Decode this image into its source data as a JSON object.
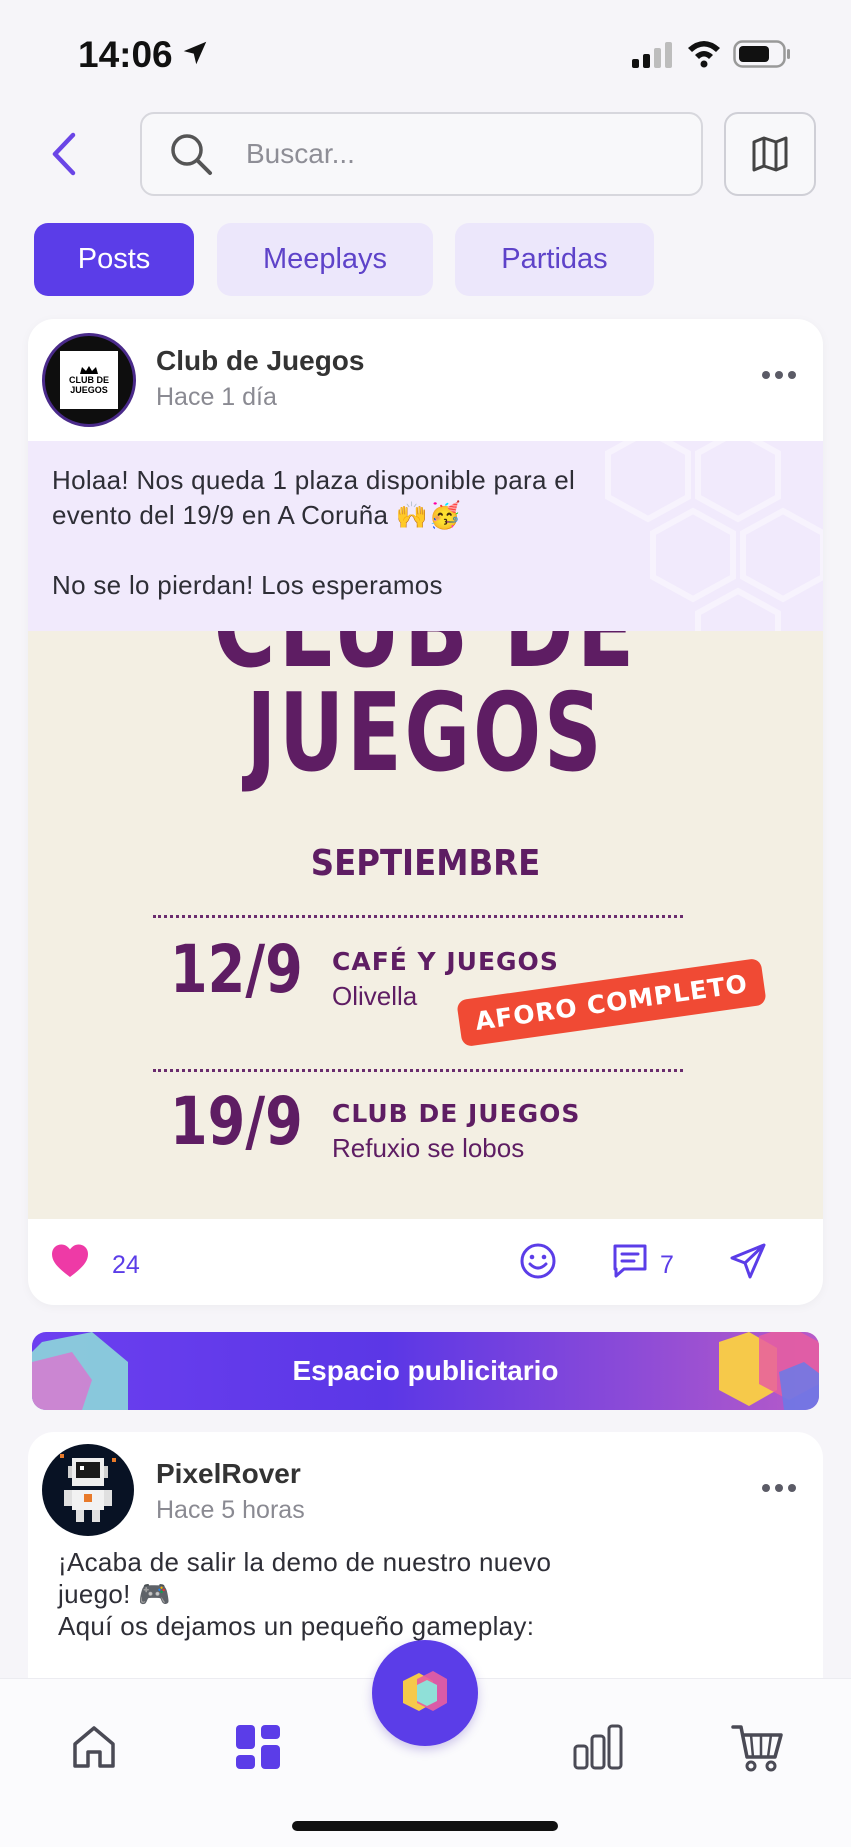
{
  "status_bar": {
    "time": "14:06"
  },
  "search": {
    "placeholder": "Buscar..."
  },
  "tabs": [
    {
      "label": "Posts",
      "active": true
    },
    {
      "label": "Meeplays",
      "active": false
    },
    {
      "label": "Partidas",
      "active": false
    }
  ],
  "post1": {
    "author": "Club de Juegos",
    "time": "Hace 1 día",
    "avatar_text": [
      "CLUB DE",
      "JUEGOS"
    ],
    "text_lines": [
      "Holaa! Nos queda 1 plaza disponible para el",
      "evento del 19/9 en A Coruña 🙌🥳",
      "",
      "No se lo pierdan! Los esperamos"
    ],
    "poster": {
      "title_top": "CLUB DE",
      "title": "JUEGOS",
      "month": "SEPTIEMBRE",
      "events": [
        {
          "date": "12/9",
          "name": "CAFÉ Y JUEGOS",
          "place": "Olivella"
        },
        {
          "date": "19/9",
          "name": "CLUB DE JUEGOS",
          "place": "Refuxio se lobos"
        }
      ],
      "stamp": "AFORO COMPLETO"
    },
    "likes": "24",
    "comments": "7"
  },
  "ad": {
    "label": "Espacio publicitario"
  },
  "post2": {
    "author": "PixelRover",
    "time": "Hace 5 horas",
    "text_lines": [
      "¡Acaba de salir la demo de nuestro nuevo",
      "juego! 🎮",
      "Aquí os dejamos un pequeño gameplay:"
    ]
  },
  "colors": {
    "accent": "#5b3de8",
    "accent_soft": "#ece7fb",
    "poster_purple": "#5e1d63",
    "stamp_red": "#f04a34",
    "like_pink": "#ee3aa6"
  },
  "icons": {
    "back": "chevron-left-icon",
    "search": "search-icon",
    "map": "map-icon",
    "like": "heart-icon",
    "react": "smile-icon",
    "comment": "comment-icon",
    "share": "send-icon",
    "nav": [
      "home-icon",
      "grid-icon",
      "app-logo-icon",
      "stats-icon",
      "cart-icon"
    ]
  }
}
